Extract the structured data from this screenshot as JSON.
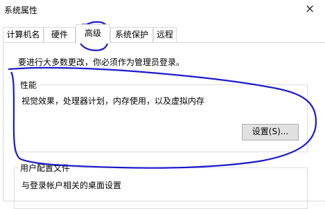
{
  "window": {
    "title": "系统属性",
    "close_glyph": "×"
  },
  "tabs": [
    {
      "label": "计算机名"
    },
    {
      "label": "硬件"
    },
    {
      "label": "高级",
      "active": true
    },
    {
      "label": "系统保护"
    },
    {
      "label": "远程"
    }
  ],
  "notice": "要进行大多数更改，你必须作为管理员登录。",
  "performance": {
    "label": "性能",
    "description": "视觉效果，处理器计划，内存使用，以及虚拟内存",
    "settings_button": "设置(S)..."
  },
  "user_profiles": {
    "label": "用户配置文件",
    "description": "与登录帐户相关的桌面设置"
  },
  "annotation_color": "#1a1acc"
}
